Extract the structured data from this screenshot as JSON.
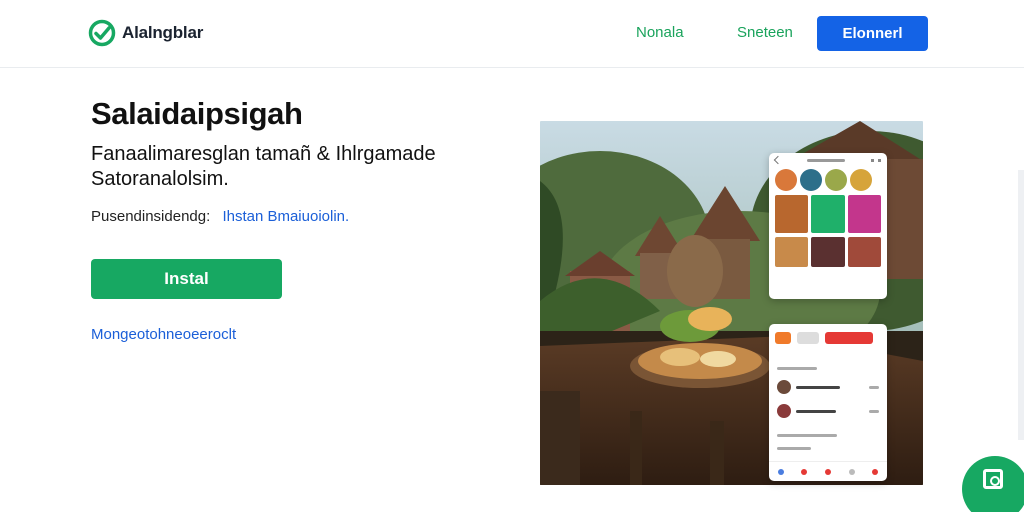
{
  "header": {
    "brand": "Alalngblar",
    "logo_icon": "check-circle-icon",
    "nav": [
      "Nonala",
      "Sneteen"
    ],
    "cta": "Elonnerl"
  },
  "hero": {
    "title": "Salaidaipsigah",
    "subtitle": "Fanaalimaresglan tamañ & Ihlrgamade Satoranalolsim.",
    "meta_label": "Pusendinsidendg:",
    "meta_link": "Ihstan Bmaiuoiolin.",
    "install_button": "Instal",
    "secondary_link": "Mongeotohneoeeroclt"
  },
  "image": {
    "description_icons": [
      "phone-screen-icon"
    ]
  },
  "fab": {
    "icon": "camera-icon"
  },
  "colors": {
    "accent_green": "#17a862",
    "primary_blue": "#1463e6",
    "link_blue": "#1b5fd8",
    "nav_green": "#1aa35c"
  }
}
